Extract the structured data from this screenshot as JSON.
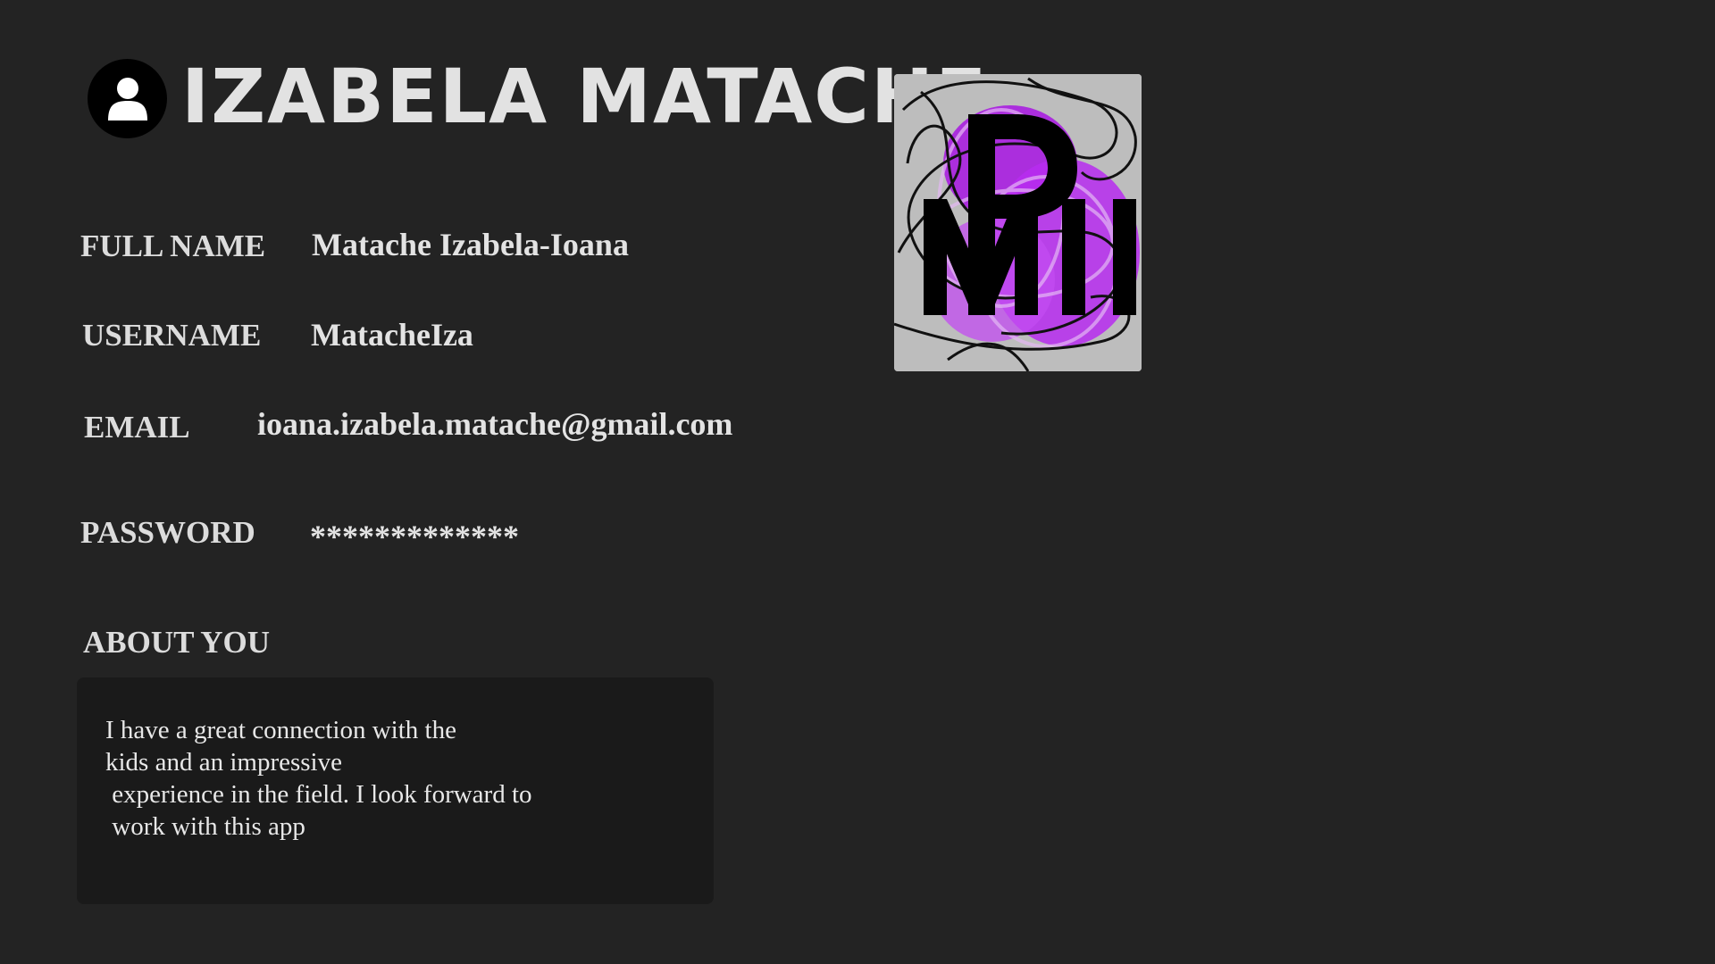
{
  "profile": {
    "title": "IZABELA MATACHE",
    "fields": {
      "full_name": {
        "label": "FULL NAME",
        "value": "Matache Izabela-Ioana"
      },
      "username": {
        "label": "USERNAME",
        "value": "MatacheIza"
      },
      "email": {
        "label": "EMAIL",
        "value": "ioana.izabela.matache@gmail.com"
      },
      "password": {
        "label": "PASSWORD",
        "value": "*************"
      }
    },
    "about": {
      "label": "ABOUT YOU",
      "text": "I have a great connection with the\nkids and an impressive\n experience in the field. I look forward to\n work with this app"
    }
  },
  "icons": {
    "avatar": "user-icon"
  },
  "colors": {
    "background": "#232323",
    "text": "#e6e6e6",
    "about_box": "#1a1a1a",
    "logo_accent": "#b026f0"
  }
}
